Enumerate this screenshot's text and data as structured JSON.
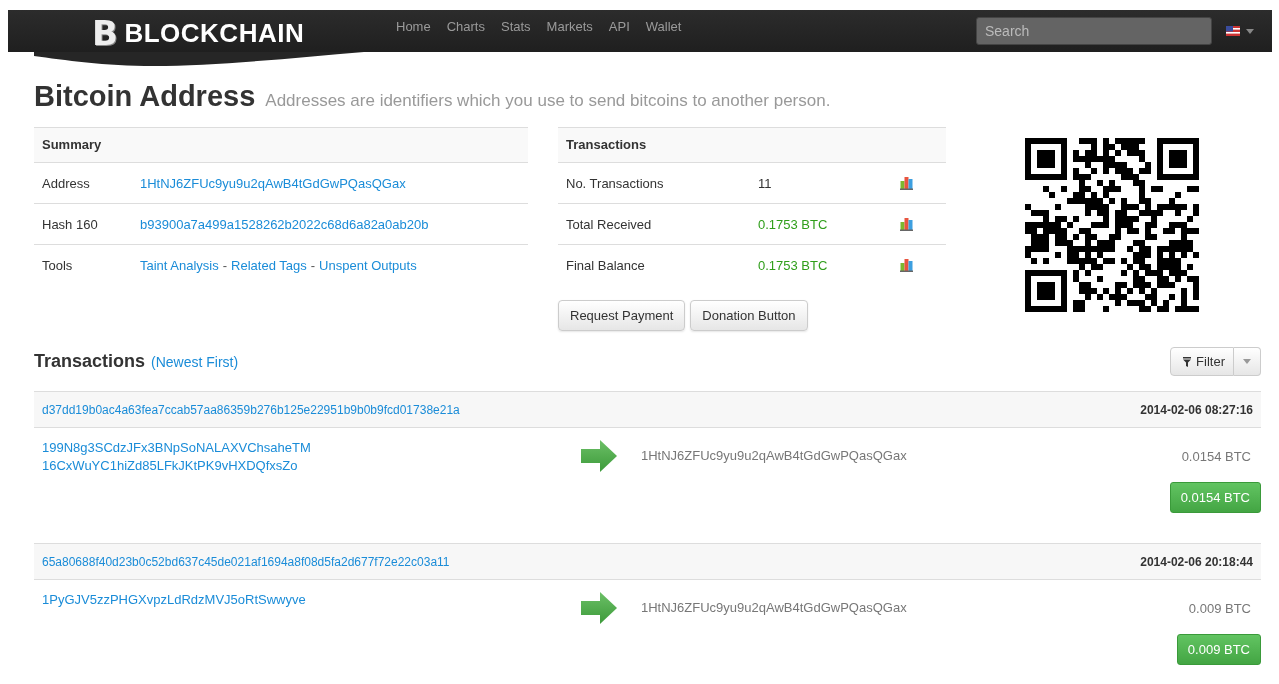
{
  "navbar": {
    "logo": {
      "mark": "B",
      "text": "BLOCKCHAIN"
    },
    "links": [
      {
        "label": "Home"
      },
      {
        "label": "Charts"
      },
      {
        "label": "Stats"
      },
      {
        "label": "Markets"
      },
      {
        "label": "API"
      },
      {
        "label": "Wallet"
      }
    ],
    "search": {
      "placeholder": "Search"
    }
  },
  "heading": {
    "title": "Bitcoin Address",
    "subtitle": "Addresses are identifiers which you use to send bitcoins to another person."
  },
  "summary": {
    "title": "Summary",
    "rows": [
      {
        "label": "Address",
        "kind": "link",
        "value": "1HtNJ6ZFUc9yu9u2qAwB4tGdGwPQasQGax"
      },
      {
        "label": "Hash 160",
        "kind": "link",
        "value": "b93900a7a499a1528262b2022c68d6a82a0ab20b"
      },
      {
        "label": "Tools",
        "kind": "links",
        "links": [
          "Taint Analysis",
          "Related Tags",
          "Unspent Outputs"
        ],
        "separator": "-"
      }
    ]
  },
  "stats": {
    "title": "Transactions",
    "rows": [
      {
        "label": "No. Transactions",
        "value": "11",
        "color": "#333333"
      },
      {
        "label": "Total Received",
        "value": "0.1753 BTC",
        "color": "#2f9e1a"
      },
      {
        "label": "Final Balance",
        "value": "0.1753 BTC",
        "color": "#2f9e1a"
      }
    ],
    "buttons": [
      "Request Payment",
      "Donation Button"
    ]
  },
  "transactions": {
    "title": "Transactions",
    "note": "(Newest First)",
    "filter": "Filter",
    "items": [
      {
        "hash": "d37dd19b0ac4a63fea7ccab57aa86359b276b125e22951b9b0b9fcd01738e21a",
        "time": "2014-02-06 08:27:16",
        "inputs": [
          "199N8g3SCdzJFx3BNpSoNALAXVChsaheTM",
          "16CxWuYC1hiZd85LFkJKtPK9vHXDQfxsZo"
        ],
        "output": "1HtNJ6ZFUc9yu9u2qAwB4tGdGwPQasQGax",
        "amount": "0.0154 BTC",
        "total": "0.0154 BTC"
      },
      {
        "hash": "65a80688f40d23b0c52bd637c45de021af1694a8f08d5fa2d677f72e22c03a11",
        "time": "2014-02-06 20:18:44",
        "inputs": [
          "1PyGJV5zzPHGXvpzLdRdzMVJ5oRtSwwyve"
        ],
        "output": "1HtNJ6ZFUc9yu9u2qAwB4tGdGwPQasQGax",
        "amount": "0.009 BTC",
        "total": "0.009 BTC"
      }
    ]
  }
}
